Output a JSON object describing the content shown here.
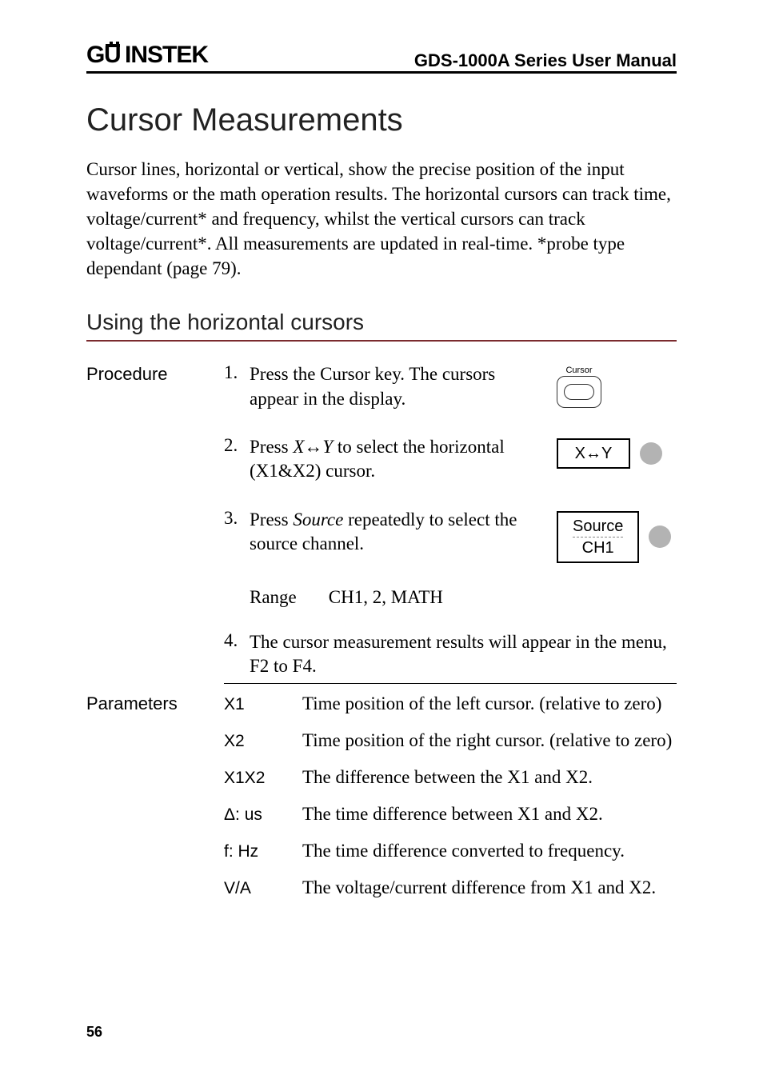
{
  "header": {
    "brand": "GWINSTEK",
    "manual_title": "GDS-1000A Series User Manual"
  },
  "section": {
    "title": "Cursor Measurements",
    "intro": "Cursor lines, horizontal or vertical, show the precise position of the input waveforms or the math operation results. The horizontal cursors can track time, voltage/current* and frequency, whilst the vertical cursors can track voltage/current*. All measurements are updated in real-time.  *probe type dependant (page 79)."
  },
  "subsection": {
    "title": "Using the horizontal cursors"
  },
  "procedure": {
    "label": "Procedure",
    "steps": [
      {
        "num": "1.",
        "text_before": "Press the Cursor key. The cursors appear in the display.",
        "graphic": {
          "type": "cursor-key",
          "label": "Cursor"
        }
      },
      {
        "num": "2.",
        "text_before": "Press ",
        "italic": "X↔Y",
        "text_after": " to select the horizontal (X1&X2) cursor.",
        "graphic": {
          "type": "softbutton",
          "top": "X↔Y"
        }
      },
      {
        "num": "3.",
        "text_before": "Press ",
        "italic": "Source",
        "text_after": " repeatedly to select the source channel.",
        "graphic": {
          "type": "softbutton",
          "top": "Source",
          "bottom": "CH1"
        }
      }
    ],
    "range": {
      "label": "Range",
      "value": "CH1, 2, MATH"
    },
    "step4": {
      "num": "4.",
      "text": "The cursor measurement results will appear in the menu, F2 to F4."
    }
  },
  "parameters": {
    "label": "Parameters",
    "rows": [
      {
        "label": "X1",
        "desc": "Time position of the left cursor. (relative to zero)"
      },
      {
        "label": "X2",
        "desc": "Time position of the right cursor. (relative to zero)"
      },
      {
        "label": "X1X2",
        "desc": "The difference between the X1 and X2."
      },
      {
        "label": "Δ: us",
        "desc": "The time difference between X1 and X2."
      },
      {
        "label": "f: Hz",
        "desc": "The time difference converted to frequency."
      },
      {
        "label": "V/A",
        "desc": "The voltage/current difference from X1 and X2."
      }
    ]
  },
  "page_number": "56"
}
